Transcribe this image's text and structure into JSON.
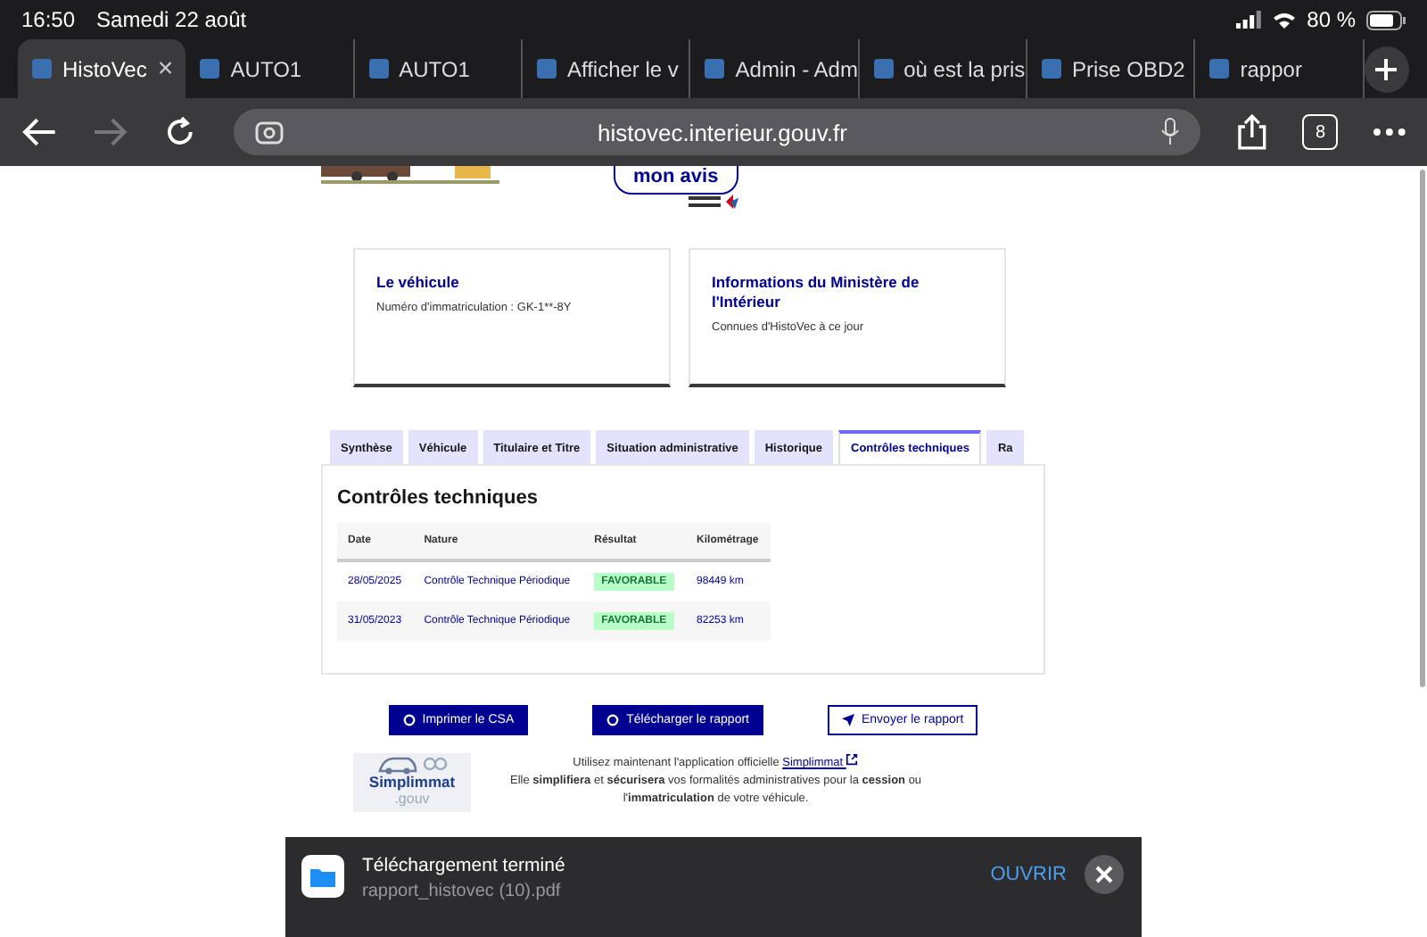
{
  "status_bar": {
    "time": "16:50",
    "date": "Samedi 22 août",
    "battery": "80 %"
  },
  "browser_tabs": [
    {
      "title": "HistoVec",
      "selected": true,
      "close": "×"
    },
    {
      "title": "AUTO1",
      "selected": false
    },
    {
      "title": "AUTO1",
      "selected": false
    },
    {
      "title": "Afficher le v",
      "selected": false
    },
    {
      "title": "Admin - Adm",
      "selected": false
    },
    {
      "title": "où est la pris",
      "selected": false
    },
    {
      "title": "Prise OBD2",
      "selected": false
    },
    {
      "title": "rappor",
      "selected": false
    }
  ],
  "address_bar": {
    "url": "histovec.interieur.gouv.fr",
    "tab_count": "8"
  },
  "feedback_badge": {
    "label": "mon avis"
  },
  "cards": [
    {
      "title": "Le véhicule",
      "text": "Numéro d'immatriculation : GK-1**-8Y"
    },
    {
      "title": "Informations du Ministère de l'Intérieur",
      "text": "Connues d'HistoVec à ce jour"
    }
  ],
  "page_tabs": [
    {
      "label": "Synthèse",
      "selected": false
    },
    {
      "label": "Véhicule",
      "selected": false
    },
    {
      "label": "Titulaire et Titre",
      "selected": false
    },
    {
      "label": "Situation administrative",
      "selected": false
    },
    {
      "label": "Historique",
      "selected": false
    },
    {
      "label": "Contrôles techniques",
      "selected": true
    },
    {
      "label": "Ra",
      "selected": false
    }
  ],
  "section_title": "Contrôles techniques",
  "table": {
    "columns": [
      "Date",
      "Nature",
      "Résultat",
      "Kilométrage"
    ],
    "rows": [
      {
        "date": "28/05/2025",
        "nature": "Contrôle Technique Périodique",
        "result": "FAVORABLE",
        "mileage": "98449 km"
      },
      {
        "date": "31/05/2023",
        "nature": "Contrôle Technique Périodique",
        "result": "FAVORABLE",
        "mileage": "82253 km"
      }
    ]
  },
  "actions": [
    {
      "label": "Imprimer le CSA",
      "kind": "primary"
    },
    {
      "label": "Télécharger le rapport",
      "kind": "primary"
    },
    {
      "label": "Envoyer le rapport",
      "kind": "secondary"
    }
  ],
  "promo": {
    "logo_main": "Simplimmat",
    "logo_sub": ".gouv",
    "line1": "Utilisez maintenant l'application officielle",
    "link": "Simplimmat",
    "line2": "Elle **simplifiera** et **sécurisera** vos formalités administratives pour la **cession** ou",
    "line3": "l'**immatriculation** de votre véhicule."
  },
  "download_toast": {
    "title": "Téléchargement terminé",
    "file": "rapport_histovec (10).pdf",
    "action": "OUVRIR"
  }
}
